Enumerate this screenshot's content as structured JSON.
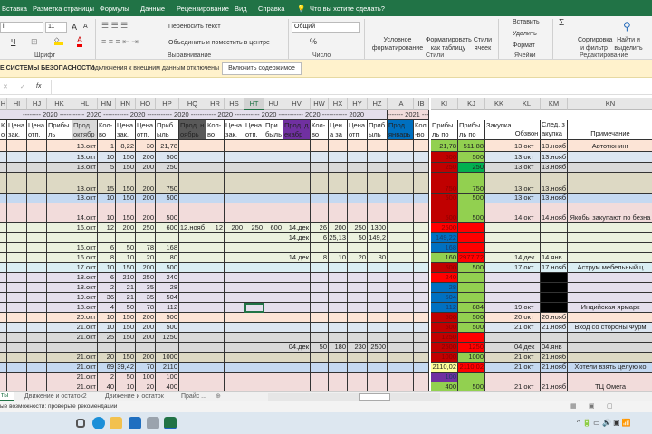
{
  "ribbon_tabs": [
    "Вставка",
    "Разметка страницы",
    "Формулы",
    "Данные",
    "Рецензирование",
    "Вид",
    "Справка"
  ],
  "tell_me": "Что вы хотите сделать?",
  "font": {
    "name": "i",
    "size": "11",
    "group_label": "Шрифт",
    "underline": "Ч",
    "grow": "A",
    "shrink": "A",
    "color_letter": "A"
  },
  "alignment": {
    "wrap": "Переносить текст",
    "merge": "Объединить и поместить в центре",
    "group_label": "Выравнивание"
  },
  "number": {
    "format": "Общий",
    "percent": "%",
    "group_label": "Число"
  },
  "styles": {
    "conditional": "Условное форматирование",
    "as_table": "Форматировать как таблицу",
    "cell_styles": "Стили ячеек",
    "group_label": "Стили"
  },
  "cells": {
    "insert": "Вставить",
    "delete": "Удалить",
    "format": "Формат",
    "group_label": "Ячейки"
  },
  "editing": {
    "sum": "Σ",
    "sort": "Сортировка и фильтр",
    "find": "Найти и выделить",
    "group_label": "Редактирование"
  },
  "security": {
    "title": "Е СИСТЕМЫ БЕЗОПАСНОСТИ",
    "message": "Подключения к внешним данным отключены",
    "button": "Включить содержимое"
  },
  "formula_bar": {
    "cancel": "✕",
    "enter": "✓",
    "fx": "fx",
    "value": ""
  },
  "columns": [
    "H",
    "HI",
    "HJ",
    "HK",
    "HL",
    "HM",
    "HN",
    "HO",
    "HP",
    "HQ",
    "HR",
    "HS",
    "HT",
    "HU",
    "HV",
    "HW",
    "HX",
    "HY",
    "HZ",
    "IA",
    "IB",
    "KI",
    "KJ",
    "KK",
    "KL",
    "KM",
    "KN"
  ],
  "year_row": [
    {
      "from": "H",
      "to": "HZ",
      "text": "-------- 2020 ----------- 2020 ----------- 2020 ----------- 2020 ----------- 2020 ----------- 2020 ----------- 2020 ----------- 2020",
      "bg": "#e4dfec"
    },
    {
      "from": "IA",
      "to": "IB",
      "text": "------- 2021 ---",
      "bg": "#f2dcdb"
    }
  ],
  "headers": {
    "H": "Кол-во",
    "HI": "Цена зак.",
    "HJ": "Цена отп.",
    "HK": "Прибыль",
    "HL": "Прод. октябр",
    "HM": "Кол-во",
    "HN": "Цена зак.",
    "HO": "Цена отп.",
    "HP": "Прибыль",
    "HQ": "Прод. ноябрь",
    "HR": "Кол-во",
    "HS": "Цена зак.",
    "HT": "Цена отп.",
    "HU": "Прибыль",
    "HV": "Прод. декабр",
    "HW": "Кол-во",
    "HX": "Цена зак.",
    "HY": "Цена отп.",
    "HZ": "Прибыль",
    "IA": "Прод. январь",
    "IB": "Кол-во",
    "KI": "Прибыль по",
    "KJ": "Прибыль по",
    "KK": "Закупка",
    "KL": "Обзвон",
    "KM": "След. закупка",
    "KN": "Примечание"
  },
  "header_fills": {
    "HL": "#d9d9d9",
    "HQ": "#595959",
    "HV": "#7030a0",
    "IA": "#0070c0"
  },
  "rows": [
    {
      "bg": "#fce4d6",
      "cells": {
        "HL": "13.окт",
        "HM": "1",
        "HN": "8,22",
        "HO": "30",
        "HP": "21,78",
        "KI": "21,78",
        "KJ": "511,88",
        "KL": "13.окт",
        "KM": "13.нояб",
        "KN": "Автотюнинг"
      },
      "fills": {
        "KI": "#92d050",
        "KJ": "#92d050"
      }
    },
    {
      "bg": "#dce6f1",
      "cells": {
        "HL": "13.окт",
        "HM": "10",
        "HN": "150",
        "HO": "200",
        "HP": "500",
        "KI": "500",
        "KJ": "500",
        "KL": "13.окт",
        "KM": "13.нояб"
      },
      "fills": {
        "KI": "#c00000",
        "KJ": "#92d050"
      }
    },
    {
      "bg": "#d9d9d9",
      "cells": {
        "HL": "13.окт",
        "HM": "5",
        "HN": "150",
        "HO": "200",
        "HP": "250",
        "KI": "250",
        "KJ": "250",
        "KL": "13.окт",
        "KM": "13.нояб"
      },
      "fills": {
        "KI": "#c00000",
        "KJ": "#00b050"
      }
    },
    {
      "bg": "#ddd9c4",
      "cells": {
        "HL": "13.окт",
        "HM": "15",
        "HN": "150",
        "HO": "200",
        "HP": "750",
        "KI": "750",
        "KJ": "750",
        "KL": "13.окт",
        "KM": "13.нояб"
      },
      "fills": {
        "KI": "#c00000",
        "KJ": "#92d050"
      }
    },
    {
      "bg": "#c5d9f1",
      "cells": {
        "HL": "13.окт",
        "HM": "10",
        "HN": "150",
        "HO": "200",
        "HP": "500",
        "KI": "500",
        "KJ": "500",
        "KL": "13.окт",
        "KM": "13.нояб"
      },
      "fills": {
        "KI": "#c00000",
        "KJ": "#92d050"
      }
    },
    {
      "bg": "#f2dcdb",
      "cells": {
        "HL": "14.окт",
        "HM": "10",
        "HN": "150",
        "HO": "200",
        "HP": "500",
        "KI": "500",
        "KJ": "500",
        "KL": "14.окт",
        "KM": "14.нояб",
        "KN": "Якобы закупают по безна"
      },
      "fills": {
        "KI": "#c00000",
        "KJ": "#92d050"
      }
    },
    {
      "bg": "#ebf1de",
      "cells": {
        "HL": "16.окт",
        "HM": "12",
        "HN": "200",
        "HO": "250",
        "HP": "600",
        "HQ": "12.нояб",
        "HR": "12",
        "HS": "200",
        "HT": "250",
        "HU": "600",
        "HV": "14.дек",
        "HW": "26",
        "HX": "200",
        "HY": "250",
        "HZ": "1300",
        "KI": "2500"
      },
      "fills": {
        "KI": "#ff0000",
        "KJ": "#ff0000"
      }
    },
    {
      "bg": "#ebf1de",
      "cells": {
        "HV": "14.дек",
        "HW": "6",
        "HX": "25,13",
        "HY": "50",
        "HZ": "149,2",
        "KI": "149,22"
      },
      "fills": {
        "KI": "#0070c0",
        "KJ": "#ff0000"
      }
    },
    {
      "bg": "#ebf1de",
      "cells": {
        "HL": "16.окт",
        "HM": "6",
        "HN": "50",
        "HO": "78",
        "HP": "168",
        "KI": "168"
      },
      "fills": {
        "KI": "#0070c0",
        "KJ": "#ff0000"
      }
    },
    {
      "bg": "#ebf1de",
      "cells": {
        "HL": "16.окт",
        "HM": "8",
        "HN": "10",
        "HO": "20",
        "HP": "80",
        "HV": "14.дек",
        "HW": "8",
        "HX": "10",
        "HY": "20",
        "HZ": "80",
        "KI": "160",
        "KJ": "2977,72",
        "KL": "14.дек",
        "KM": "14.янв"
      },
      "fills": {
        "KI": "#92d050",
        "KJ": "#ff0000"
      }
    },
    {
      "bg": "#daeef3",
      "cells": {
        "HL": "17.окт",
        "HM": "10",
        "HN": "150",
        "HO": "200",
        "HP": "500",
        "KI": "500",
        "KJ": "500",
        "KL": "17.окт",
        "KM": "17.нояб",
        "KN": "Аструм мебельный ц"
      },
      "fills": {
        "KI": "#c00000",
        "KJ": "#92d050"
      }
    },
    {
      "bg": "#e4dfec",
      "cells": {
        "HL": "18.окт",
        "HM": "6",
        "HN": "210",
        "HO": "250",
        "HP": "240",
        "KI": "240"
      },
      "fills": {
        "KI": "#ff0000",
        "KJ": "#92d050",
        "KM": "#000000"
      }
    },
    {
      "bg": "#e4dfec",
      "cells": {
        "HL": "18.окт",
        "HM": "2",
        "HN": "21",
        "HO": "35",
        "HP": "28",
        "KI": "28"
      },
      "fills": {
        "KI": "#0070c0",
        "KJ": "#92d050",
        "KM": "#000000"
      }
    },
    {
      "bg": "#e4dfec",
      "cells": {
        "HL": "19.окт",
        "HM": "36",
        "HN": "21",
        "HO": "35",
        "HP": "504",
        "KI": "504"
      },
      "fills": {
        "KI": "#0070c0",
        "KJ": "#92d050",
        "KM": "#000000"
      }
    },
    {
      "bg": "#e4dfec",
      "cells": {
        "HL": "18.окт",
        "HM": "4",
        "HN": "50",
        "HO": "78",
        "HP": "112",
        "KI": "112",
        "KJ": "884",
        "KL": "19.окт",
        "KN": "Индийская ярмарк"
      },
      "fills": {
        "KI": "#0070c0",
        "KJ": "#92d050",
        "KM": "#000000"
      }
    },
    {
      "bg": "#fce4d6",
      "cells": {
        "HL": "20.окт",
        "HM": "10",
        "HN": "150",
        "HO": "200",
        "HP": "500",
        "KI": "500",
        "KJ": "500",
        "KL": "20.окт",
        "KM": "20.нояб"
      },
      "fills": {
        "KI": "#c00000",
        "KJ": "#92d050"
      }
    },
    {
      "bg": "#dce6f1",
      "cells": {
        "HL": "21.окт",
        "HM": "10",
        "HN": "150",
        "HO": "200",
        "HP": "500",
        "KI": "500",
        "KJ": "500",
        "KL": "21.окт",
        "KM": "21.нояб",
        "KN": "Вход со стороны Фурм"
      },
      "fills": {
        "KI": "#c00000",
        "KJ": "#92d050"
      }
    },
    {
      "bg": "#d9d9d9",
      "cells": {
        "HL": "21.окт",
        "HM": "25",
        "HN": "150",
        "HO": "200",
        "HP": "1250",
        "KI": "1250"
      },
      "fills": {
        "KI": "#c00000",
        "KJ": "#ff0000"
      }
    },
    {
      "bg": "#d9d9d9",
      "cells": {
        "HV": "04.дек",
        "HW": "50",
        "HX": "180",
        "HY": "230",
        "HZ": "2500",
        "KI": "2500",
        "KJ": "1250",
        "KL": "04.дек",
        "KM": "04.янв"
      },
      "fills": {
        "KI": "#c00000",
        "KJ": "#ff0000"
      }
    },
    {
      "bg": "#ddd9c4",
      "cells": {
        "HL": "21.окт",
        "HM": "20",
        "HN": "150",
        "HO": "200",
        "HP": "1000",
        "KI": "1000",
        "KJ": "1000",
        "KL": "21.окт",
        "KM": "21.нояб"
      },
      "fills": {
        "KI": "#c00000",
        "KJ": "#92d050"
      }
    },
    {
      "bg": "#c5d9f1",
      "cells": {
        "HL": "21.окт",
        "HM": "69",
        "HN": "39,42",
        "HO": "70",
        "HP": "2110",
        "KI": "2110,02",
        "KJ": "2110,02",
        "KL": "21.окт",
        "KM": "21.нояб",
        "KN": "Хотели взять целую ко"
      },
      "fills": {
        "KI": "#ffff99",
        "KJ": "#ff0000"
      }
    },
    {
      "bg": "#f2dcdb",
      "cells": {
        "HL": "21.окт",
        "HM": "2",
        "HN": "50",
        "HO": "100",
        "HP": "100",
        "KI": "100"
      },
      "fills": {
        "KI": "#7030a0",
        "KJ": "#92d050"
      }
    },
    {
      "bg": "#f2dcdb",
      "cells": {
        "HL": "21.окт",
        "HM": "40",
        "HN": "10",
        "HO": "20",
        "HP": "400",
        "KI": "400",
        "KJ": "500",
        "KL": "21.окт",
        "KM": "21.нояб",
        "KN": "ТЦ Омега"
      },
      "fills": {
        "KI": "#92d050",
        "KJ": "#92d050"
      }
    }
  ],
  "sheet_tabs": [
    "ты",
    "Движение и остаток2",
    "Движение и остаток",
    "Прайс ..."
  ],
  "status": "ые возможности: проверьте рекомендации",
  "accent": "#217346"
}
